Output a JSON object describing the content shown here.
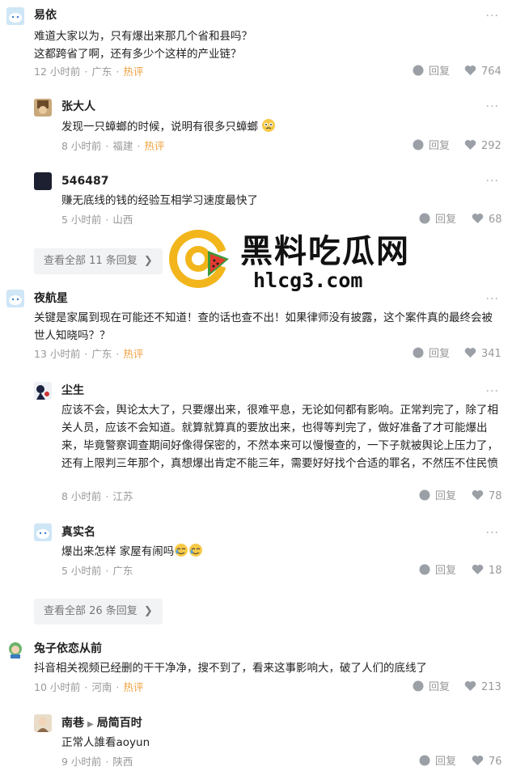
{
  "comments": [
    {
      "name": "易依",
      "text": "难道大家以为，只有爆出来那几个省和县吗？\n这都跨省了啊，还有多少个这样的产业链？",
      "time": "12 小时前",
      "location": "广东",
      "tag": "热评",
      "reply": "回复",
      "likes": "764"
    },
    {
      "name": "张大人",
      "text": "发现一只蟑螂的时候，说明有很多只蟑螂",
      "time": "8 小时前",
      "location": "福建",
      "tag": "热评",
      "reply": "回复",
      "likes": "292"
    },
    {
      "name": "546487",
      "text": "赚无底线的钱的经验互相学习速度最快了",
      "time": "5 小时前",
      "location": "山西",
      "tag": "",
      "reply": "回复",
      "likes": "68"
    },
    {
      "name": "夜航星",
      "text": "关键是家属到现在可能还不知道！查的话也查不出！如果律师没有披露，这个案件真的最终会被世人知晓吗？？",
      "time": "13 小时前",
      "location": "广东",
      "tag": "热评",
      "reply": "回复",
      "likes": "341"
    },
    {
      "name": "尘生",
      "text": "应该不会，舆论太大了，只要爆出来，很难平息，无论如何都有影响。正常判完了，除了相关人员，应该不会知道。就算就算真的要放出来，也得等判完了，做好准备了才可能爆出来，毕竟警察调查期间好像得保密的，不然本来可以慢慢查的，一下子就被舆论上压力了，还有上限判三年那个，真想爆出肯定不能三年，需要好好找个合适的罪名，不然压不住民愤",
      "time": "8 小时前",
      "location": "江苏",
      "tag": "",
      "reply": "回复",
      "likes": "78"
    },
    {
      "name": "真实名",
      "text": "爆出来怎样 家屋有闹吗",
      "time": "5 小时前",
      "location": "广东",
      "tag": "",
      "reply": "回复",
      "likes": "18"
    },
    {
      "name": "兔子依恋从前",
      "text": "抖音相关视频已经删的干干净净，搜不到了，看来这事影响大，破了人们的底线了",
      "time": "10 小时前",
      "location": "河南",
      "tag": "热评",
      "reply": "回复",
      "likes": "213"
    },
    {
      "name": "南巷",
      "reply_to": "局简百时",
      "text": "正常人誰看aoyun",
      "time": "9 小时前",
      "location": "陕西",
      "tag": "",
      "reply": "回复",
      "likes": "76"
    }
  ],
  "view_all": [
    {
      "label": "查看全部 11 条回复"
    },
    {
      "label": "查看全部 26 条回复"
    }
  ],
  "more_glyph": "···",
  "meta_sep": "·",
  "watermark": {
    "title": "黑料吃瓜网",
    "url": "hlcg3.com"
  },
  "colors": {
    "hot": "#f1a140",
    "meta": "#999999",
    "viewall_bg": "#f2f3f5"
  }
}
